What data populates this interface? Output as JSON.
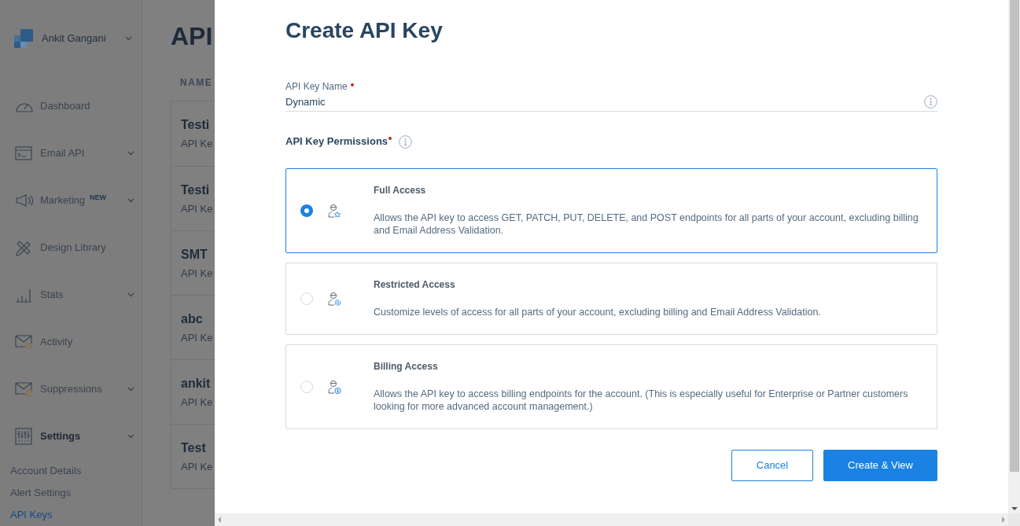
{
  "sidebar": {
    "account": {
      "name": "Ankit Gangani"
    },
    "items": [
      {
        "label": "Dashboard",
        "expandable": false,
        "selected": false
      },
      {
        "label": "Email API",
        "expandable": true,
        "selected": false
      },
      {
        "label": "Marketing",
        "badge": "NEW",
        "expandable": true,
        "selected": false
      },
      {
        "label": "Design Library",
        "expandable": false,
        "selected": false
      },
      {
        "label": "Stats",
        "expandable": true,
        "selected": false
      },
      {
        "label": "Activity",
        "expandable": false,
        "selected": false
      },
      {
        "label": "Suppressions",
        "expandable": true,
        "selected": false
      },
      {
        "label": "Settings",
        "expandable": true,
        "selected": true
      }
    ],
    "subitems": [
      {
        "label": "Account Details",
        "selected": false
      },
      {
        "label": "Alert Settings",
        "selected": false
      },
      {
        "label": "API Keys",
        "selected": true
      }
    ]
  },
  "page": {
    "title": "API",
    "columns": [
      "NAME"
    ],
    "rows": [
      {
        "name": "Testi",
        "subtitle": "API Ke"
      },
      {
        "name": "Testi",
        "subtitle": "API Ke"
      },
      {
        "name": "SMT",
        "subtitle": "API Ke"
      },
      {
        "name": "abc",
        "subtitle": "API Ke"
      },
      {
        "name": "ankit",
        "subtitle": "API Ke"
      },
      {
        "name": "Test",
        "subtitle": "API Ke"
      }
    ]
  },
  "modal": {
    "title": "Create API Key",
    "field": {
      "label": "API Key Name",
      "required": true,
      "value": "Dynamic"
    },
    "permissions": {
      "label": "API Key Permissions",
      "required": true,
      "options": [
        {
          "title": "Full Access",
          "description": "Allows the API key to access GET, PATCH, PUT, DELETE, and POST endpoints for all parts of your account, excluding billing and Email Address Validation.",
          "selected": true
        },
        {
          "title": "Restricted Access",
          "description": "Customize levels of access for all parts of your account, excluding billing and Email Address Validation.",
          "selected": false
        },
        {
          "title": "Billing Access",
          "description": "Allows the API key to access billing endpoints for the account. (This is especially useful for Enterprise or Partner customers looking for more advanced account management.)",
          "selected": false
        }
      ]
    },
    "buttons": [
      {
        "label": "Cancel",
        "kind": "secondary"
      },
      {
        "label": "Create & View",
        "kind": "primary"
      }
    ]
  }
}
